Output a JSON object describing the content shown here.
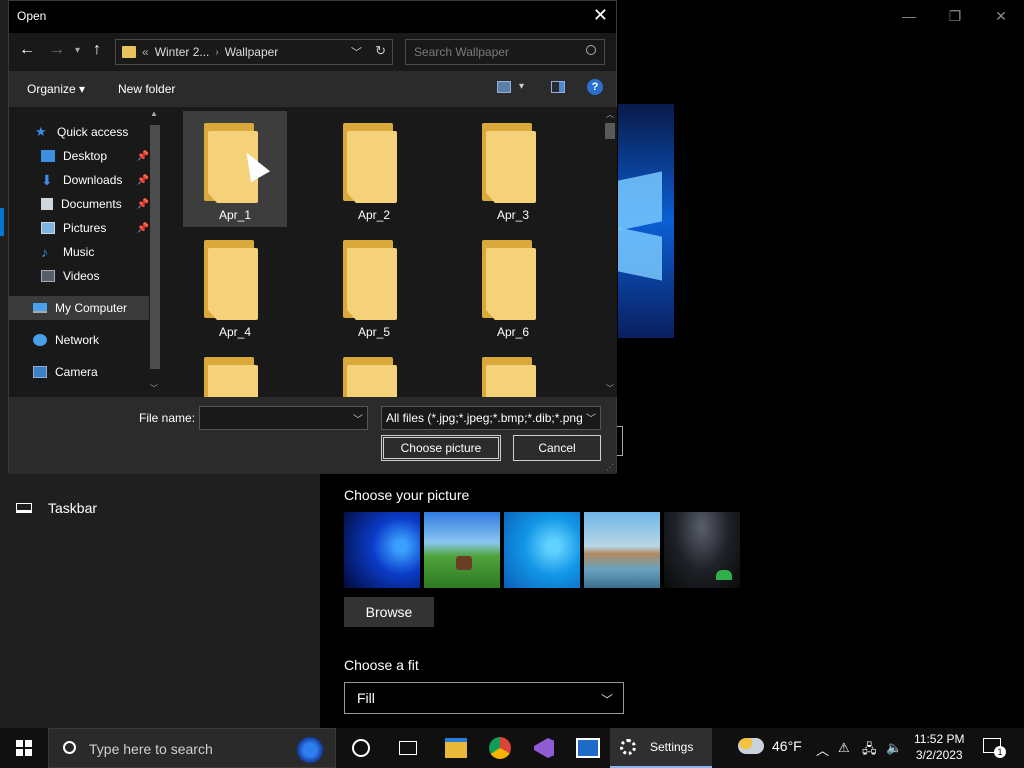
{
  "settings": {
    "window_controls": [
      "—",
      "❐",
      "✕"
    ],
    "taskbar_label": "Taskbar",
    "choose_picture_label": "Choose your picture",
    "browse_label": "Browse",
    "choose_fit_label": "Choose a fit",
    "fit_value": "Fill"
  },
  "dialog": {
    "title": "Open",
    "breadcrumb": {
      "overflow": "«",
      "parent": "Winter 2...",
      "current": "Wallpaper"
    },
    "search_placeholder": "Search Wallpaper",
    "toolbar": {
      "organize": "Organize ▾",
      "new_folder": "New folder",
      "help": "?"
    },
    "nav": [
      {
        "label": "Quick access",
        "icon": "star-icon",
        "pinned": false
      },
      {
        "label": "Desktop",
        "icon": "desktop-icon",
        "pinned": true
      },
      {
        "label": "Downloads",
        "icon": "download-icon",
        "pinned": true
      },
      {
        "label": "Documents",
        "icon": "documents-icon",
        "pinned": true
      },
      {
        "label": "Pictures",
        "icon": "pictures-icon",
        "pinned": true
      },
      {
        "label": "Music",
        "icon": "music-icon",
        "pinned": false
      },
      {
        "label": "Videos",
        "icon": "videos-icon",
        "pinned": false
      },
      {
        "label": "My Computer",
        "icon": "computer-icon",
        "pinned": false
      },
      {
        "label": "Network",
        "icon": "network-icon",
        "pinned": false
      },
      {
        "label": "Camera",
        "icon": "camera-icon",
        "pinned": false
      }
    ],
    "folders": [
      "Apr_1",
      "Apr_2",
      "Apr_3",
      "Apr_4",
      "Apr_5",
      "Apr_6",
      "",
      "",
      ""
    ],
    "file_name_label": "File name:",
    "file_name_value": "",
    "file_type": "All files (*.jpg;*.jpeg;*.bmp;*.dib;*.png",
    "choose_button": "Choose picture",
    "cancel_button": "Cancel"
  },
  "taskbar": {
    "search_placeholder": "Type here to search",
    "settings_label": "Settings",
    "temperature": "46°F",
    "time": "11:52 PM",
    "date": "3/2/2023",
    "notification_count": "1"
  }
}
